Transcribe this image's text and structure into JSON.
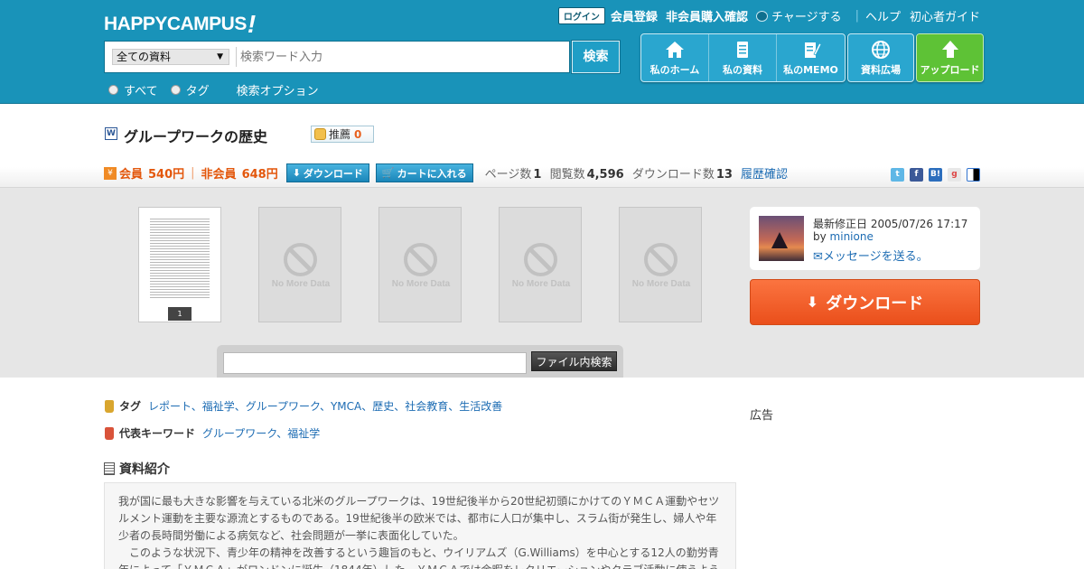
{
  "header": {
    "logo": "HAPPYCAMPUS",
    "logo_mark": "!",
    "login": "ログイン",
    "member_register": "会員登録",
    "nonmember_purchase": "非会員購入確認",
    "charge": "チャージする",
    "help": "ヘルプ",
    "beginner_guide": "初心者ガイド",
    "search": {
      "category": "全ての資料",
      "placeholder": "検索ワード入力",
      "button": "検索"
    },
    "options": {
      "all": "すべて",
      "tag": "タグ",
      "search_options": "検索オプション"
    },
    "nav": [
      {
        "label": "私のホーム",
        "icon": "home-icon"
      },
      {
        "label": "私の資料",
        "icon": "document-icon"
      },
      {
        "label": "私のMEMO",
        "icon": "memo-icon"
      },
      {
        "label": "資料広場",
        "icon": "globe-icon"
      },
      {
        "label": "アップロード",
        "icon": "upload-arrow-icon"
      }
    ]
  },
  "document": {
    "title": "グループワークの歴史",
    "recommend_label": "推薦",
    "recommend_count": "0",
    "member_label": "会員",
    "member_price": "540円",
    "nonmember_label": "非会員",
    "nonmember_price": "648円",
    "download_btn": "ダウンロード",
    "cart_btn": "カートに入れる",
    "pages_label": "ページ数",
    "pages": "1",
    "views_label": "閲覧数",
    "views": "4,596",
    "downloads_label": "ダウンロード数",
    "downloads": "13",
    "history": "履歴確認"
  },
  "preview": {
    "page_number": "1",
    "no_data": "No More Data",
    "infile_search_btn": "ファイル内検索"
  },
  "author": {
    "updated": "最新修正日 2005/07/26 17:17",
    "by": "by",
    "name": "minione",
    "message": "メッセージを送る。",
    "big_download": "ダウンロード"
  },
  "tags": {
    "label": "タグ",
    "values": "レポート、福祉学、グループワーク、YMCA、歴史、社会教育、生活改善"
  },
  "keywords": {
    "label": "代表キーワード",
    "values": "グループワーク、福祉学"
  },
  "intro": {
    "title": "資料紹介",
    "p1": "我が国に最も大きな影響を与えている北米のグループワークは、19世紀後半から20世紀初頭にかけてのＹＭＣＡ運動やセツルメント運動を主要な源流とするものである。19世紀後半の欧米では、都市に人口が集中し、スラム街が発生し、婦人や年少者の長時間労働による病気など、社会問題が一挙に表面化していた。",
    "p2": "　このような状況下、青少年の精神を改善するという趣旨のもと、ウイリアムズ（G.Williams）を中心とする12人の勤労青年によって「ＹＭＣＡ」がロンドンに誕生（1844年）した。ＹＭＣＡでは余暇をレクリエーションやクラブ活動に使うよう"
  },
  "ad": "広告",
  "colors": {
    "header_bg": "#1993b9",
    "accent_orange": "#ea4f1b",
    "upload_green": "#5ec236",
    "link_blue": "#1d6cb3"
  }
}
